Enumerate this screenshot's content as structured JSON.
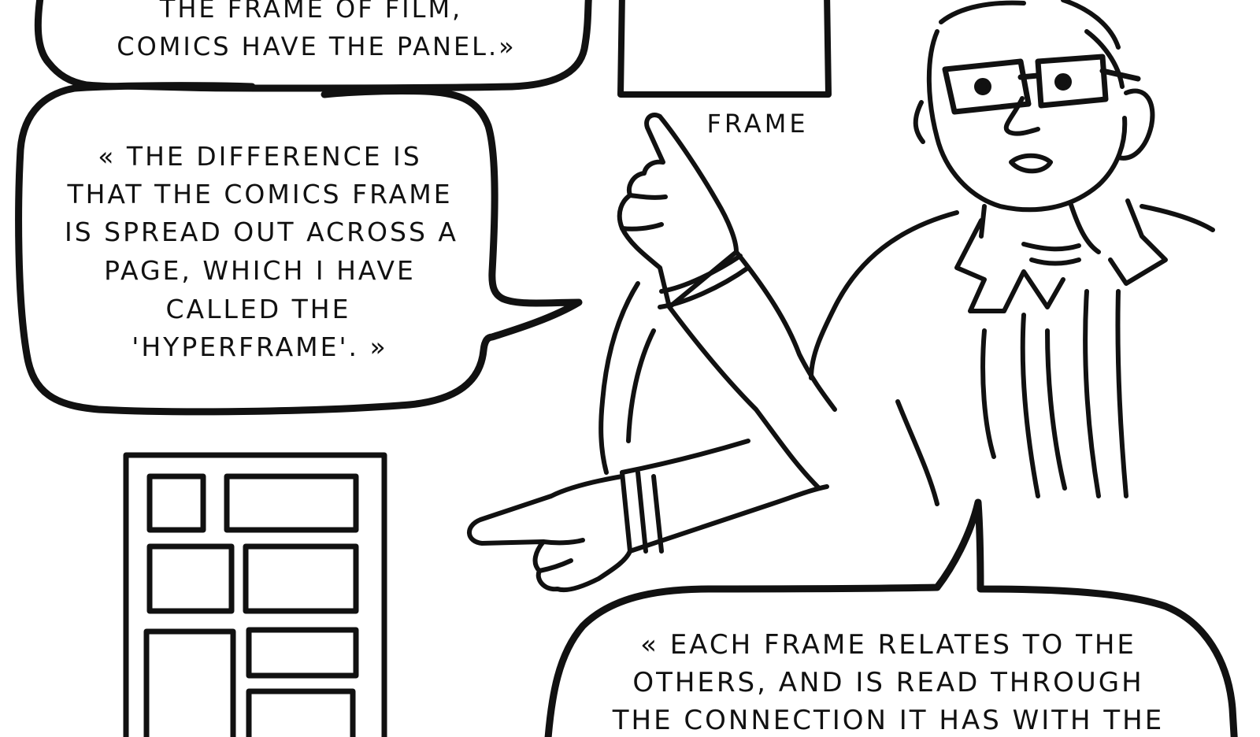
{
  "bubble_top": {
    "lines": [
      "THE FRAME OF FILM,",
      "COMICS HAVE THE PANEL.»"
    ]
  },
  "bubble_left": {
    "lines": [
      "« THE DIFFERENCE IS",
      "THAT THE COMICS FRAME",
      "IS SPREAD OUT ACROSS A",
      "PAGE, WHICH I HAVE",
      "CALLED THE",
      "'HYPERFRAME'. »"
    ]
  },
  "frame_label": "FRAME",
  "bubble_bottom": {
    "lines": [
      "« EACH FRAME RELATES TO THE",
      "OTHERS, AND IS READ THROUGH",
      "THE CONNECTION IT HAS WITH THE"
    ]
  },
  "colors": {
    "ink": "#111111",
    "paper": "#ffffff"
  }
}
